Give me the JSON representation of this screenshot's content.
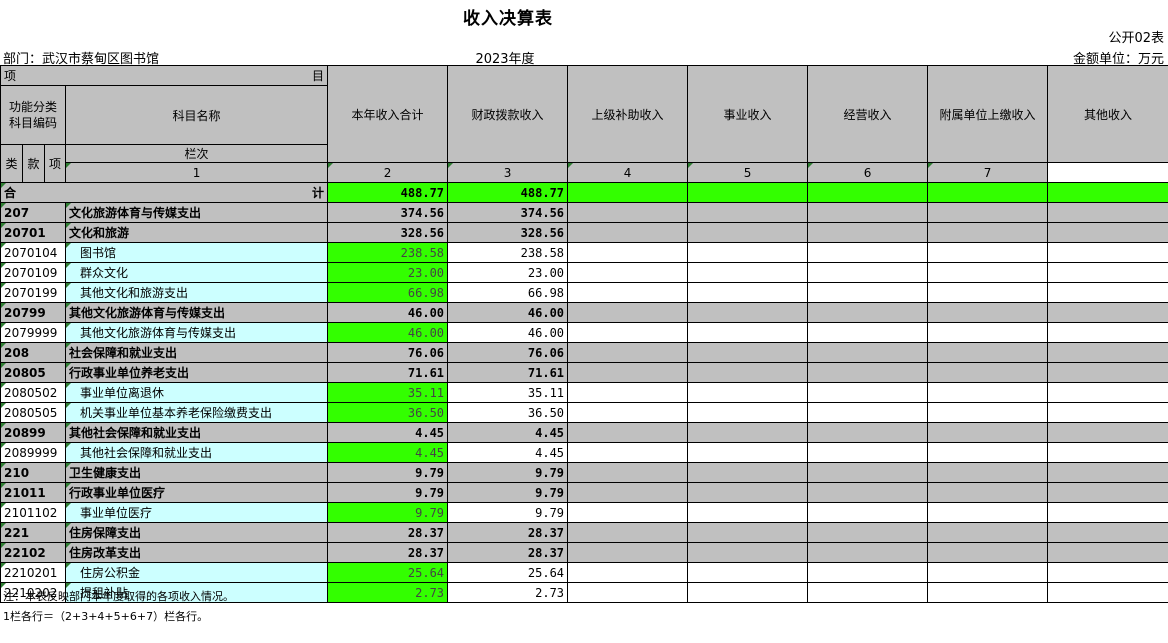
{
  "title": "收入决算表",
  "table_code": "公开02表",
  "department": "部门：武汉市蔡甸区图书馆",
  "year": "2023年度",
  "unit": "金额单位：万元",
  "header": {
    "xiang_mu_left": "项",
    "xiang_mu_right": "目",
    "func_code_line1": "功能分类",
    "func_code_line2": "科目编码",
    "subject_name": "科目名称",
    "lei": "类",
    "kuan": "款",
    "xiang": "项",
    "lan_ci": "栏次",
    "columns": [
      "本年收入合计",
      "财政拨款收入",
      "上级补助收入",
      "事业收入",
      "经营收入",
      "附属单位上缴收入",
      "其他收入"
    ],
    "col_numbers": [
      "1",
      "2",
      "3",
      "4",
      "5",
      "6",
      "7"
    ]
  },
  "total": {
    "label_left": "合",
    "label_right": "计",
    "c1": "488.77",
    "c2": "488.77"
  },
  "rows": [
    {
      "code": "207",
      "name": "文化旅游体育与传媒支出",
      "c1": "374.56",
      "c2": "374.56",
      "level": "group"
    },
    {
      "code": "20701",
      "name": "文化和旅游",
      "c1": "328.56",
      "c2": "328.56",
      "level": "group"
    },
    {
      "code": "2070104",
      "name": "图书馆",
      "c1": "238.58",
      "c2": "238.58",
      "level": "leaf"
    },
    {
      "code": "2070109",
      "name": "群众文化",
      "c1": "23.00",
      "c2": "23.00",
      "level": "leaf"
    },
    {
      "code": "2070199",
      "name": "其他文化和旅游支出",
      "c1": "66.98",
      "c2": "66.98",
      "level": "leaf"
    },
    {
      "code": "20799",
      "name": "其他文化旅游体育与传媒支出",
      "c1": "46.00",
      "c2": "46.00",
      "level": "group"
    },
    {
      "code": "2079999",
      "name": "其他文化旅游体育与传媒支出",
      "c1": "46.00",
      "c2": "46.00",
      "level": "leaf"
    },
    {
      "code": "208",
      "name": "社会保障和就业支出",
      "c1": "76.06",
      "c2": "76.06",
      "level": "group"
    },
    {
      "code": "20805",
      "name": "行政事业单位养老支出",
      "c1": "71.61",
      "c2": "71.61",
      "level": "group"
    },
    {
      "code": "2080502",
      "name": "事业单位离退休",
      "c1": "35.11",
      "c2": "35.11",
      "level": "leaf"
    },
    {
      "code": "2080505",
      "name": "机关事业单位基本养老保险缴费支出",
      "c1": "36.50",
      "c2": "36.50",
      "level": "leaf"
    },
    {
      "code": "20899",
      "name": "其他社会保障和就业支出",
      "c1": "4.45",
      "c2": "4.45",
      "level": "group"
    },
    {
      "code": "2089999",
      "name": "其他社会保障和就业支出",
      "c1": "4.45",
      "c2": "4.45",
      "level": "leaf"
    },
    {
      "code": "210",
      "name": "卫生健康支出",
      "c1": "9.79",
      "c2": "9.79",
      "level": "group"
    },
    {
      "code": "21011",
      "name": "行政事业单位医疗",
      "c1": "9.79",
      "c2": "9.79",
      "level": "group"
    },
    {
      "code": "2101102",
      "name": "事业单位医疗",
      "c1": "9.79",
      "c2": "9.79",
      "level": "leaf"
    },
    {
      "code": "221",
      "name": "住房保障支出",
      "c1": "28.37",
      "c2": "28.37",
      "level": "group"
    },
    {
      "code": "22102",
      "name": "住房改革支出",
      "c1": "28.37",
      "c2": "28.37",
      "level": "group"
    },
    {
      "code": "2210201",
      "name": "住房公积金",
      "c1": "25.64",
      "c2": "25.64",
      "level": "leaf"
    },
    {
      "code": "2210202",
      "name": "提租补贴",
      "c1": "2.73",
      "c2": "2.73",
      "level": "leaf"
    }
  ],
  "notes": [
    "注：本表反映部门本年度取得的各项收入情况。",
    "1栏各行＝（2+3+4+5+6+7）栏各行。"
  ],
  "colors": {
    "header_gray": "#c0c0c0",
    "value_green": "#33ff00",
    "name_cyan": "#ccffff"
  }
}
